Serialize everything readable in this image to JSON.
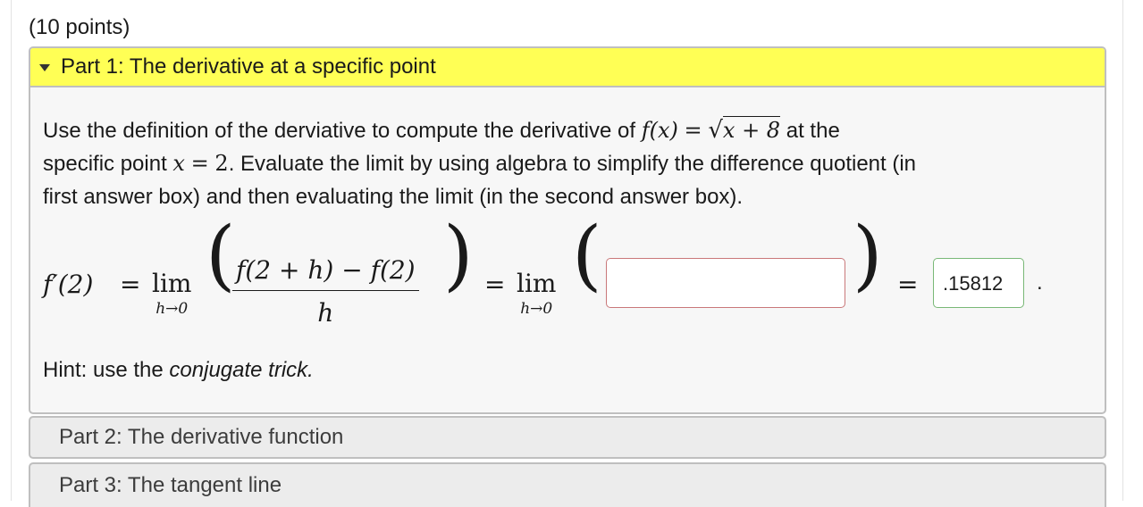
{
  "points": "(10 points)",
  "part1": {
    "title": "Part 1: The derivative at a specific point",
    "intro_a": "Use the definition of the derviative to compute the derivative of",
    "intro_b": "at the",
    "intro_c": "specific point",
    "intro_d": ". Evaluate the limit by using algebra to simplify the difference quotient (in",
    "intro_e": "first answer box) and then evaluating the limit (in the second answer box).",
    "math": {
      "fx": "f(x)",
      "eq": "=",
      "radicand": "x + 8",
      "xvar": "x",
      "xval": "2",
      "lhs": "f′(2)",
      "lim": "lim",
      "lim_sub": "h→0",
      "frac_num": "f(2 + h) − f(2)",
      "frac_den": "h"
    },
    "answer1": {
      "value": ""
    },
    "answer2": {
      "value": ".15812"
    },
    "period": ".",
    "hint_prefix": "Hint: use the ",
    "hint_emph": "conjugate trick."
  },
  "part2": {
    "title": "Part 2: The derivative function"
  },
  "part3": {
    "title": "Part 3: The tangent line"
  },
  "colors": {
    "header_yellow": "#ffff55",
    "answer1_border": "#c9787a",
    "answer2_border": "#79b877"
  },
  "icons": {
    "part1_toggle": "triangle-down-icon"
  }
}
